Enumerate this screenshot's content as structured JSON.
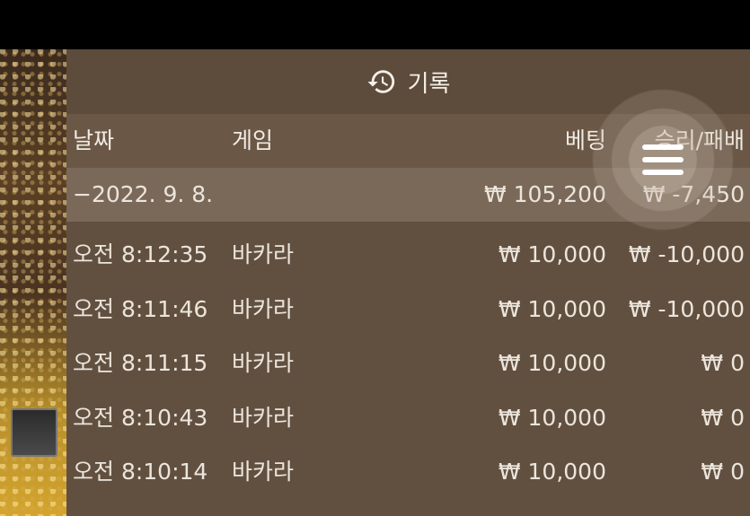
{
  "header": {
    "title": "기록",
    "icon": "history-icon"
  },
  "columns": {
    "date": "날짜",
    "game": "게임",
    "bet": "베팅",
    "winloss": "승리/패배"
  },
  "summary": {
    "date": "−2022. 9. 8.",
    "bet": "₩ 105,200",
    "winloss": "₩ -7,450"
  },
  "rows": [
    {
      "time": "오전 8:12:35",
      "game": "바카라",
      "bet": "₩ 10,000",
      "winloss": "₩ -10,000"
    },
    {
      "time": "오전 8:11:46",
      "game": "바카라",
      "bet": "₩ 10,000",
      "winloss": "₩ -10,000"
    },
    {
      "time": "오전 8:11:15",
      "game": "바카라",
      "bet": "₩ 10,000",
      "winloss": "₩ 0"
    },
    {
      "time": "오전 8:10:43",
      "game": "바카라",
      "bet": "₩ 10,000",
      "winloss": "₩ 0"
    },
    {
      "time": "오전 8:10:14",
      "game": "바카라",
      "bet": "₩ 10,000",
      "winloss": "₩ 0"
    }
  ],
  "menu": {
    "icon": "hamburger-menu-icon"
  },
  "colors": {
    "panel_bg": "#615040",
    "header_bg": "#5d4b3b",
    "summary_bg": "#7a6959",
    "text": "#f2ede6"
  }
}
